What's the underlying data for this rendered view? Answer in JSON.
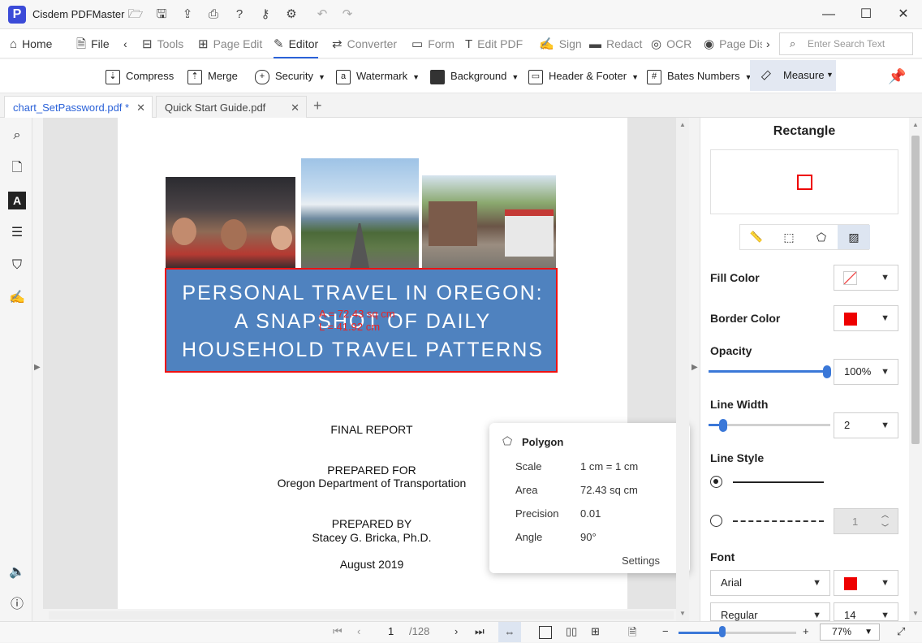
{
  "app": {
    "title": "Cisdem PDFMaster",
    "logo": "P"
  },
  "menu": {
    "home": "Home",
    "file": "File",
    "tools": "Tools",
    "page_edit": "Page Edit",
    "editor": "Editor",
    "converter": "Converter",
    "form": "Form",
    "edit_pdf": "Edit PDF",
    "sign": "Sign",
    "redact": "Redact",
    "ocr": "OCR",
    "page_dis": "Page Dis",
    "search_placeholder": "Enter Search Text"
  },
  "subbar": {
    "compress": "Compress",
    "merge": "Merge",
    "security": "Security",
    "watermark": "Watermark",
    "background": "Background",
    "header_footer": "Header & Footer",
    "bates": "Bates Numbers",
    "measure": "Measure"
  },
  "tabs": [
    {
      "label": "chart_SetPassword.pdf *"
    },
    {
      "label": "Quick Start Guide.pdf"
    }
  ],
  "document": {
    "title_lines": [
      "PERSONAL TRAVEL IN OREGON:",
      "A SNAPSHOT OF DAILY",
      "HOUSEHOLD TRAVEL PATTERNS"
    ],
    "measure_area": "A = 72.43 sq cm",
    "measure_length": "L = 41.92 cm",
    "final_report": "FINAL REPORT",
    "prepared_for": "PREPARED FOR",
    "prepared_for_org": "Oregon Department of Transportation",
    "prepared_by": "PREPARED BY",
    "prepared_by_name": "Stacey G. Bricka, Ph.D.",
    "date": "August 2019"
  },
  "popup": {
    "title": "Polygon",
    "scale_label": "Scale",
    "scale_value": "1 cm = 1 cm",
    "area_label": "Area",
    "area_value": "72.43 sq cm",
    "precision_label": "Precision",
    "precision_value": "0.01",
    "angle_label": "Angle",
    "angle_value": "90°",
    "settings": "Settings"
  },
  "panel": {
    "title": "Rectangle",
    "fill_color": "Fill Color",
    "border_color": "Border Color",
    "opacity": "Opacity",
    "opacity_value": "100%",
    "line_width": "Line Width",
    "line_width_value": "2",
    "line_style": "Line Style",
    "dash_value": "1",
    "font": "Font",
    "font_name": "Arial",
    "font_style": "Regular",
    "font_size": "14",
    "accent_color": "#e00000"
  },
  "status": {
    "page": "1",
    "total": "/128",
    "zoom": "77%"
  }
}
